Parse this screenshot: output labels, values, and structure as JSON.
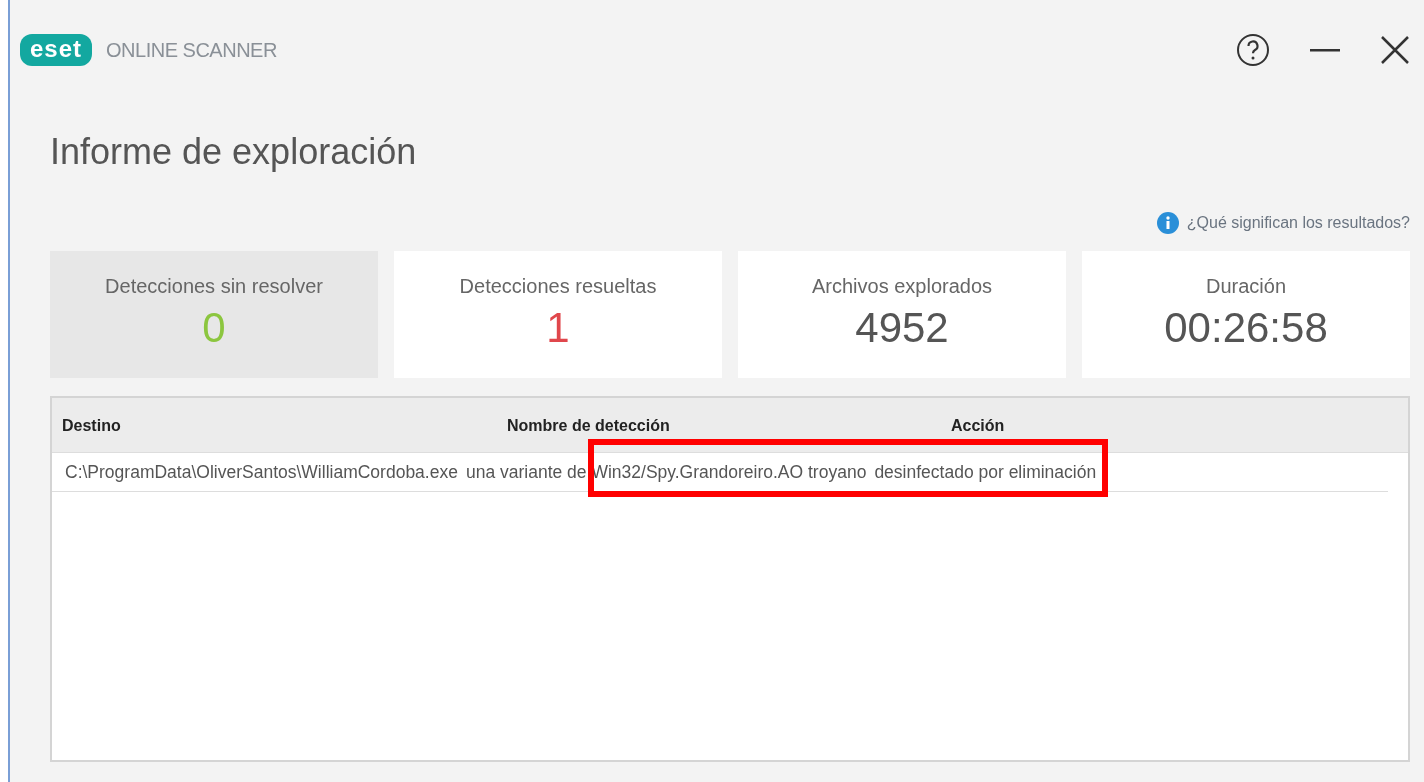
{
  "window": {
    "brand": "eset",
    "title": "ONLINE SCANNER"
  },
  "heading": "Informe de exploración",
  "help_link": "¿Qué significan los resultados?",
  "cards": [
    {
      "label": "Detecciones sin resolver",
      "value": "0",
      "color": "#8cc63f",
      "selected": true
    },
    {
      "label": "Detecciones resueltas",
      "value": "1",
      "color": "#e0474c",
      "selected": false
    },
    {
      "label": "Archivos explorados",
      "value": "4952",
      "color": "#555555",
      "selected": false
    },
    {
      "label": "Duración",
      "value": "00:26:58",
      "color": "#555555",
      "selected": false
    }
  ],
  "table": {
    "columns": [
      "Destino",
      "Nombre de detección",
      "Acción"
    ],
    "rows": [
      [
        "C:\\ProgramData\\OliverSantos\\WilliamCordoba.exe",
        "una variante de Win32/Spy.Grandoreiro.AO troyano",
        "desinfectado por eliminación"
      ]
    ]
  },
  "annotation": {
    "kind": "frame"
  }
}
